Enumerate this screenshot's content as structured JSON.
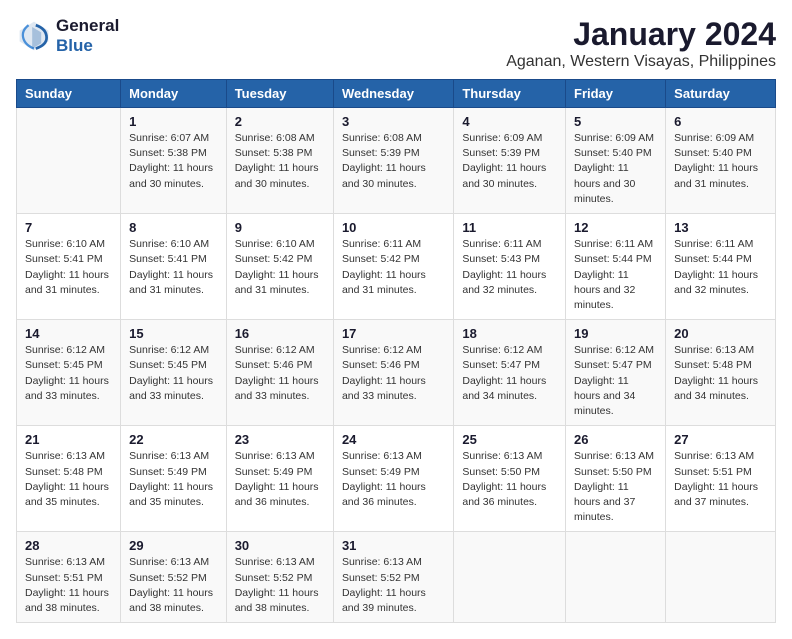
{
  "logo": {
    "line1": "General",
    "line2": "Blue"
  },
  "title": "January 2024",
  "subtitle": "Aganan, Western Visayas, Philippines",
  "headers": [
    "Sunday",
    "Monday",
    "Tuesday",
    "Wednesday",
    "Thursday",
    "Friday",
    "Saturday"
  ],
  "weeks": [
    [
      {
        "day": "",
        "sunrise": "",
        "sunset": "",
        "daylight": ""
      },
      {
        "day": "1",
        "sunrise": "Sunrise: 6:07 AM",
        "sunset": "Sunset: 5:38 PM",
        "daylight": "Daylight: 11 hours and 30 minutes."
      },
      {
        "day": "2",
        "sunrise": "Sunrise: 6:08 AM",
        "sunset": "Sunset: 5:38 PM",
        "daylight": "Daylight: 11 hours and 30 minutes."
      },
      {
        "day": "3",
        "sunrise": "Sunrise: 6:08 AM",
        "sunset": "Sunset: 5:39 PM",
        "daylight": "Daylight: 11 hours and 30 minutes."
      },
      {
        "day": "4",
        "sunrise": "Sunrise: 6:09 AM",
        "sunset": "Sunset: 5:39 PM",
        "daylight": "Daylight: 11 hours and 30 minutes."
      },
      {
        "day": "5",
        "sunrise": "Sunrise: 6:09 AM",
        "sunset": "Sunset: 5:40 PM",
        "daylight": "Daylight: 11 hours and 30 minutes."
      },
      {
        "day": "6",
        "sunrise": "Sunrise: 6:09 AM",
        "sunset": "Sunset: 5:40 PM",
        "daylight": "Daylight: 11 hours and 31 minutes."
      }
    ],
    [
      {
        "day": "7",
        "sunrise": "Sunrise: 6:10 AM",
        "sunset": "Sunset: 5:41 PM",
        "daylight": "Daylight: 11 hours and 31 minutes."
      },
      {
        "day": "8",
        "sunrise": "Sunrise: 6:10 AM",
        "sunset": "Sunset: 5:41 PM",
        "daylight": "Daylight: 11 hours and 31 minutes."
      },
      {
        "day": "9",
        "sunrise": "Sunrise: 6:10 AM",
        "sunset": "Sunset: 5:42 PM",
        "daylight": "Daylight: 11 hours and 31 minutes."
      },
      {
        "day": "10",
        "sunrise": "Sunrise: 6:11 AM",
        "sunset": "Sunset: 5:42 PM",
        "daylight": "Daylight: 11 hours and 31 minutes."
      },
      {
        "day": "11",
        "sunrise": "Sunrise: 6:11 AM",
        "sunset": "Sunset: 5:43 PM",
        "daylight": "Daylight: 11 hours and 32 minutes."
      },
      {
        "day": "12",
        "sunrise": "Sunrise: 6:11 AM",
        "sunset": "Sunset: 5:44 PM",
        "daylight": "Daylight: 11 hours and 32 minutes."
      },
      {
        "day": "13",
        "sunrise": "Sunrise: 6:11 AM",
        "sunset": "Sunset: 5:44 PM",
        "daylight": "Daylight: 11 hours and 32 minutes."
      }
    ],
    [
      {
        "day": "14",
        "sunrise": "Sunrise: 6:12 AM",
        "sunset": "Sunset: 5:45 PM",
        "daylight": "Daylight: 11 hours and 33 minutes."
      },
      {
        "day": "15",
        "sunrise": "Sunrise: 6:12 AM",
        "sunset": "Sunset: 5:45 PM",
        "daylight": "Daylight: 11 hours and 33 minutes."
      },
      {
        "day": "16",
        "sunrise": "Sunrise: 6:12 AM",
        "sunset": "Sunset: 5:46 PM",
        "daylight": "Daylight: 11 hours and 33 minutes."
      },
      {
        "day": "17",
        "sunrise": "Sunrise: 6:12 AM",
        "sunset": "Sunset: 5:46 PM",
        "daylight": "Daylight: 11 hours and 33 minutes."
      },
      {
        "day": "18",
        "sunrise": "Sunrise: 6:12 AM",
        "sunset": "Sunset: 5:47 PM",
        "daylight": "Daylight: 11 hours and 34 minutes."
      },
      {
        "day": "19",
        "sunrise": "Sunrise: 6:12 AM",
        "sunset": "Sunset: 5:47 PM",
        "daylight": "Daylight: 11 hours and 34 minutes."
      },
      {
        "day": "20",
        "sunrise": "Sunrise: 6:13 AM",
        "sunset": "Sunset: 5:48 PM",
        "daylight": "Daylight: 11 hours and 34 minutes."
      }
    ],
    [
      {
        "day": "21",
        "sunrise": "Sunrise: 6:13 AM",
        "sunset": "Sunset: 5:48 PM",
        "daylight": "Daylight: 11 hours and 35 minutes."
      },
      {
        "day": "22",
        "sunrise": "Sunrise: 6:13 AM",
        "sunset": "Sunset: 5:49 PM",
        "daylight": "Daylight: 11 hours and 35 minutes."
      },
      {
        "day": "23",
        "sunrise": "Sunrise: 6:13 AM",
        "sunset": "Sunset: 5:49 PM",
        "daylight": "Daylight: 11 hours and 36 minutes."
      },
      {
        "day": "24",
        "sunrise": "Sunrise: 6:13 AM",
        "sunset": "Sunset: 5:49 PM",
        "daylight": "Daylight: 11 hours and 36 minutes."
      },
      {
        "day": "25",
        "sunrise": "Sunrise: 6:13 AM",
        "sunset": "Sunset: 5:50 PM",
        "daylight": "Daylight: 11 hours and 36 minutes."
      },
      {
        "day": "26",
        "sunrise": "Sunrise: 6:13 AM",
        "sunset": "Sunset: 5:50 PM",
        "daylight": "Daylight: 11 hours and 37 minutes."
      },
      {
        "day": "27",
        "sunrise": "Sunrise: 6:13 AM",
        "sunset": "Sunset: 5:51 PM",
        "daylight": "Daylight: 11 hours and 37 minutes."
      }
    ],
    [
      {
        "day": "28",
        "sunrise": "Sunrise: 6:13 AM",
        "sunset": "Sunset: 5:51 PM",
        "daylight": "Daylight: 11 hours and 38 minutes."
      },
      {
        "day": "29",
        "sunrise": "Sunrise: 6:13 AM",
        "sunset": "Sunset: 5:52 PM",
        "daylight": "Daylight: 11 hours and 38 minutes."
      },
      {
        "day": "30",
        "sunrise": "Sunrise: 6:13 AM",
        "sunset": "Sunset: 5:52 PM",
        "daylight": "Daylight: 11 hours and 38 minutes."
      },
      {
        "day": "31",
        "sunrise": "Sunrise: 6:13 AM",
        "sunset": "Sunset: 5:52 PM",
        "daylight": "Daylight: 11 hours and 39 minutes."
      },
      {
        "day": "",
        "sunrise": "",
        "sunset": "",
        "daylight": ""
      },
      {
        "day": "",
        "sunrise": "",
        "sunset": "",
        "daylight": ""
      },
      {
        "day": "",
        "sunrise": "",
        "sunset": "",
        "daylight": ""
      }
    ]
  ]
}
